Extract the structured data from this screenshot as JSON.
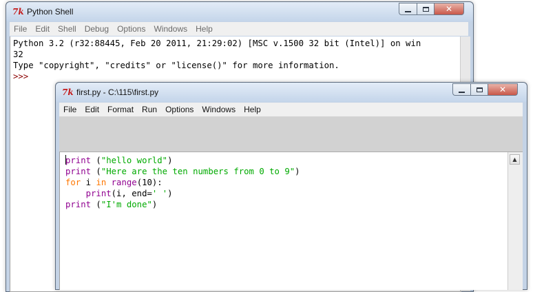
{
  "shell": {
    "title": "Python Shell",
    "menu": [
      "File",
      "Edit",
      "Shell",
      "Debug",
      "Options",
      "Windows",
      "Help"
    ],
    "lines": [
      "Python 3.2 (r32:88445, Feb 20 2011, 21:29:02) [MSC v.1500 32 bit (Intel)] on win",
      "32",
      "Type \"copyright\", \"credits\" or \"license()\" for more information."
    ],
    "prompt": ">>>"
  },
  "editor": {
    "title": "first.py - C:\\115\\first.py",
    "menu": [
      "File",
      "Edit",
      "Format",
      "Run",
      "Options",
      "Windows",
      "Help"
    ],
    "code": {
      "l1_builtin": "print",
      "l1_rest": " (",
      "l1_str": "\"hello world\"",
      "l1_end": ")",
      "l2_builtin": "print",
      "l2_rest": " (",
      "l2_str": "\"Here are the ten numbers from 0 to 9\"",
      "l2_end": ")",
      "l3_kw1": "for",
      "l3_mid1": " i ",
      "l3_kw2": "in",
      "l3_sp": " ",
      "l3_builtin": "range",
      "l3_end": "(10):",
      "l4_indent": "    ",
      "l4_builtin": "print",
      "l4_mid": "(i, end=",
      "l4_str": "' '",
      "l4_end": ")",
      "l5_builtin": "print",
      "l5_rest": " (",
      "l5_str": "\"I'm done\"",
      "l5_end": ")"
    }
  },
  "window_buttons": {
    "minimize": "minimize",
    "maximize": "maximize",
    "close": "✕"
  },
  "icons": {
    "app": "tk-feather-icon"
  },
  "colors": {
    "keyword": "#ff7700",
    "builtin": "#900090",
    "string": "#00aa00",
    "prompt": "#8b0000"
  }
}
